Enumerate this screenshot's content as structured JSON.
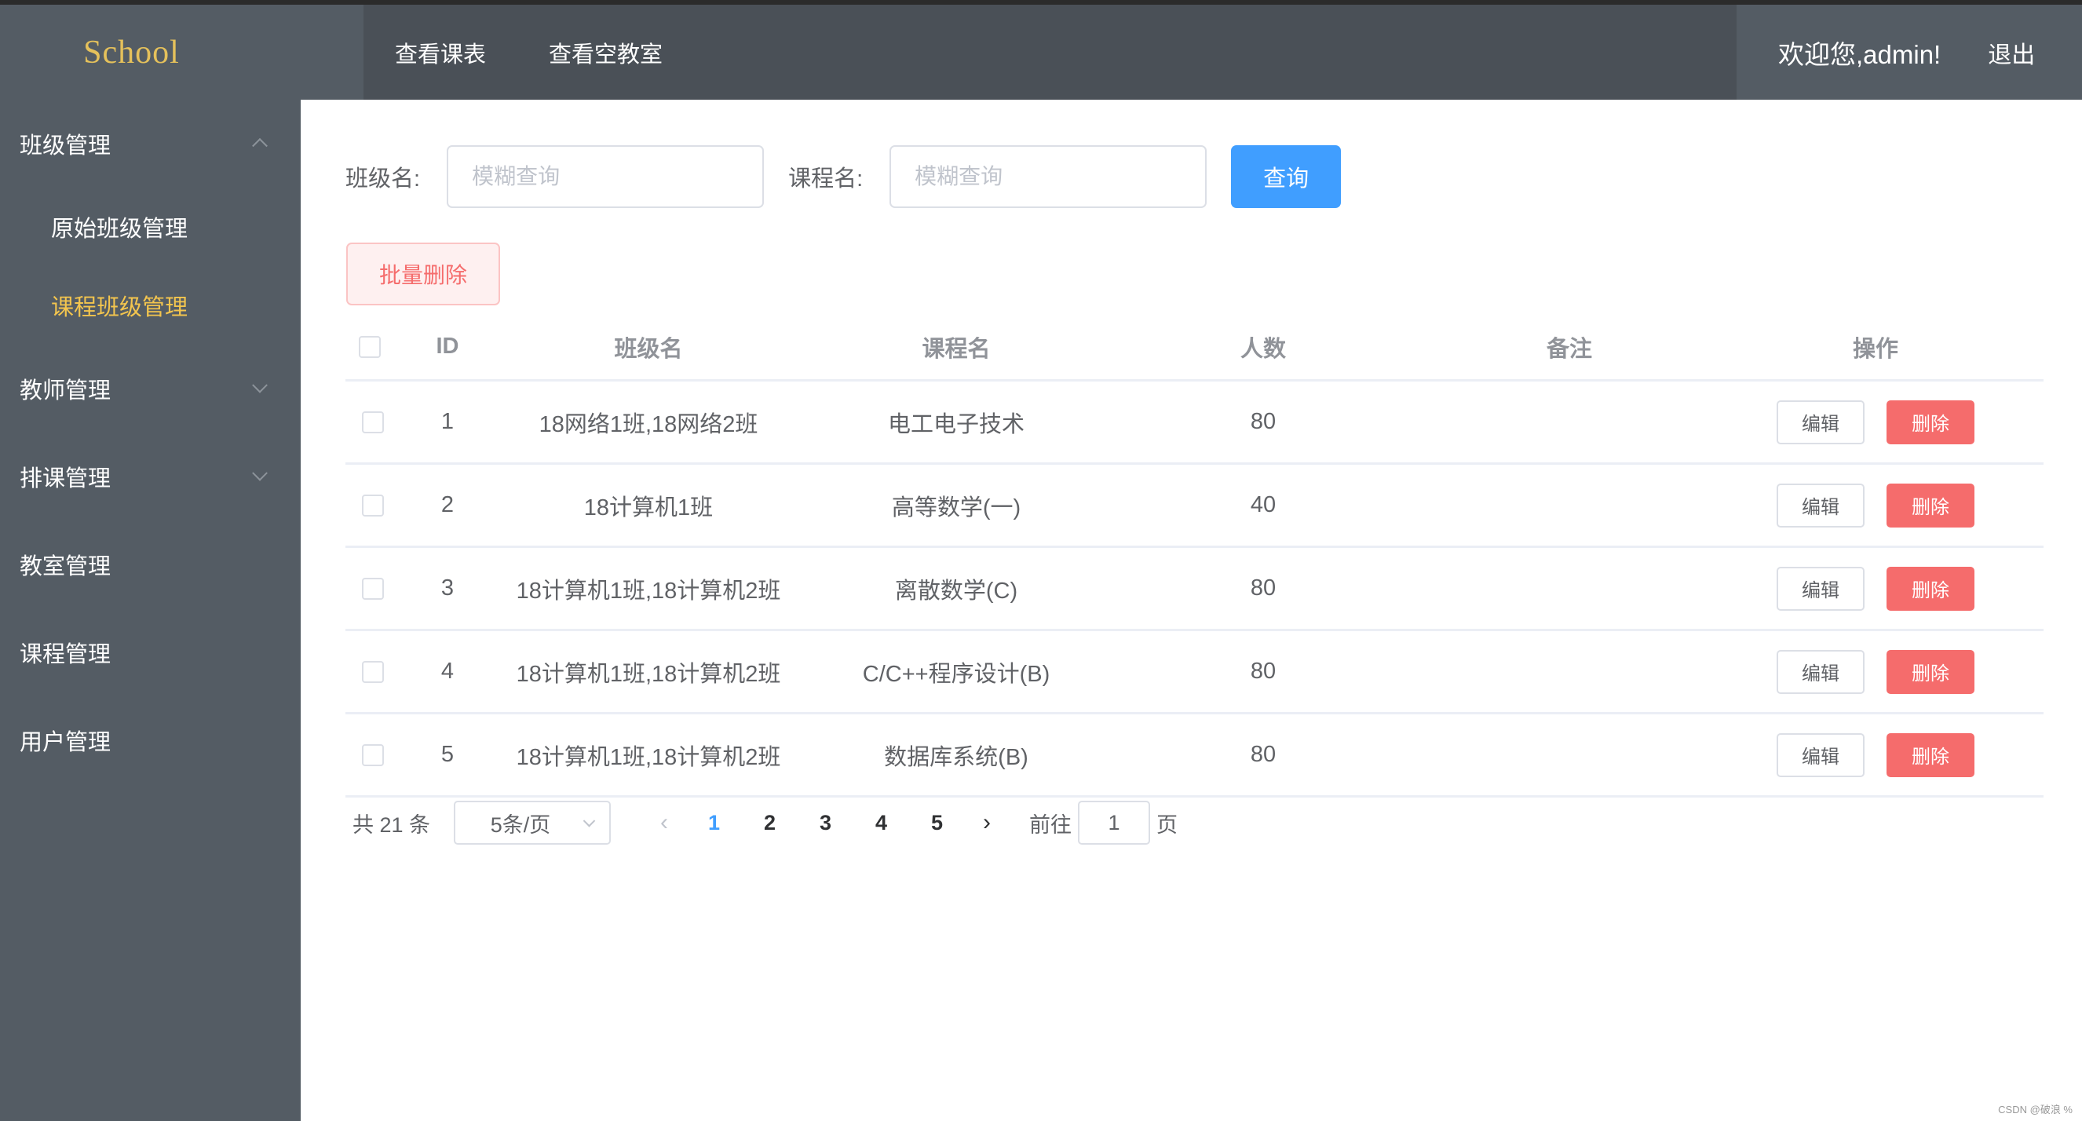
{
  "header": {
    "logo": "School",
    "nav": [
      {
        "label": "查看课表"
      },
      {
        "label": "查看空教室"
      }
    ],
    "welcome": "欢迎您,admin!",
    "logout": "退出"
  },
  "sidebar": {
    "items": [
      {
        "label": "班级管理",
        "expanded": true,
        "children": [
          {
            "label": "原始班级管理",
            "active": false
          },
          {
            "label": "课程班级管理",
            "active": true
          }
        ]
      },
      {
        "label": "教师管理",
        "expanded": false
      },
      {
        "label": "排课管理",
        "expanded": false
      },
      {
        "label": "教室管理"
      },
      {
        "label": "课程管理"
      },
      {
        "label": "用户管理"
      }
    ]
  },
  "search": {
    "class_label": "班级名:",
    "class_placeholder": "模糊查询",
    "class_value": "",
    "course_label": "课程名:",
    "course_placeholder": "模糊查询",
    "course_value": "",
    "query_button": "查询"
  },
  "toolbar": {
    "batch_delete": "批量删除"
  },
  "table": {
    "columns": [
      "ID",
      "班级名",
      "课程名",
      "人数",
      "备注",
      "操作"
    ],
    "rows": [
      {
        "id": "1",
        "class_name": "18网络1班,18网络2班",
        "course_name": "电工电子技术",
        "count": "80",
        "note": ""
      },
      {
        "id": "2",
        "class_name": "18计算机1班",
        "course_name": "高等数学(一)",
        "count": "40",
        "note": ""
      },
      {
        "id": "3",
        "class_name": "18计算机1班,18计算机2班",
        "course_name": "离散数学(C)",
        "count": "80",
        "note": ""
      },
      {
        "id": "4",
        "class_name": "18计算机1班,18计算机2班",
        "course_name": "C/C++程序设计(B)",
        "count": "80",
        "note": ""
      },
      {
        "id": "5",
        "class_name": "18计算机1班,18计算机2班",
        "course_name": "数据库系统(B)",
        "count": "80",
        "note": ""
      }
    ],
    "edit_label": "编辑",
    "delete_label": "删除"
  },
  "pagination": {
    "total": "共 21 条",
    "page_size": "5条/页",
    "pages": [
      "1",
      "2",
      "3",
      "4",
      "5"
    ],
    "current_page": "1",
    "prev": "‹",
    "next": "›",
    "jump_label": "前往",
    "jump_value": "1",
    "jump_suffix": "页"
  },
  "colors": {
    "primary": "#409eff",
    "danger": "#f56c6c",
    "sidebar_bg": "#545c64",
    "active_menu": "#f3c54e"
  },
  "watermark": "CSDN @破浪 %"
}
